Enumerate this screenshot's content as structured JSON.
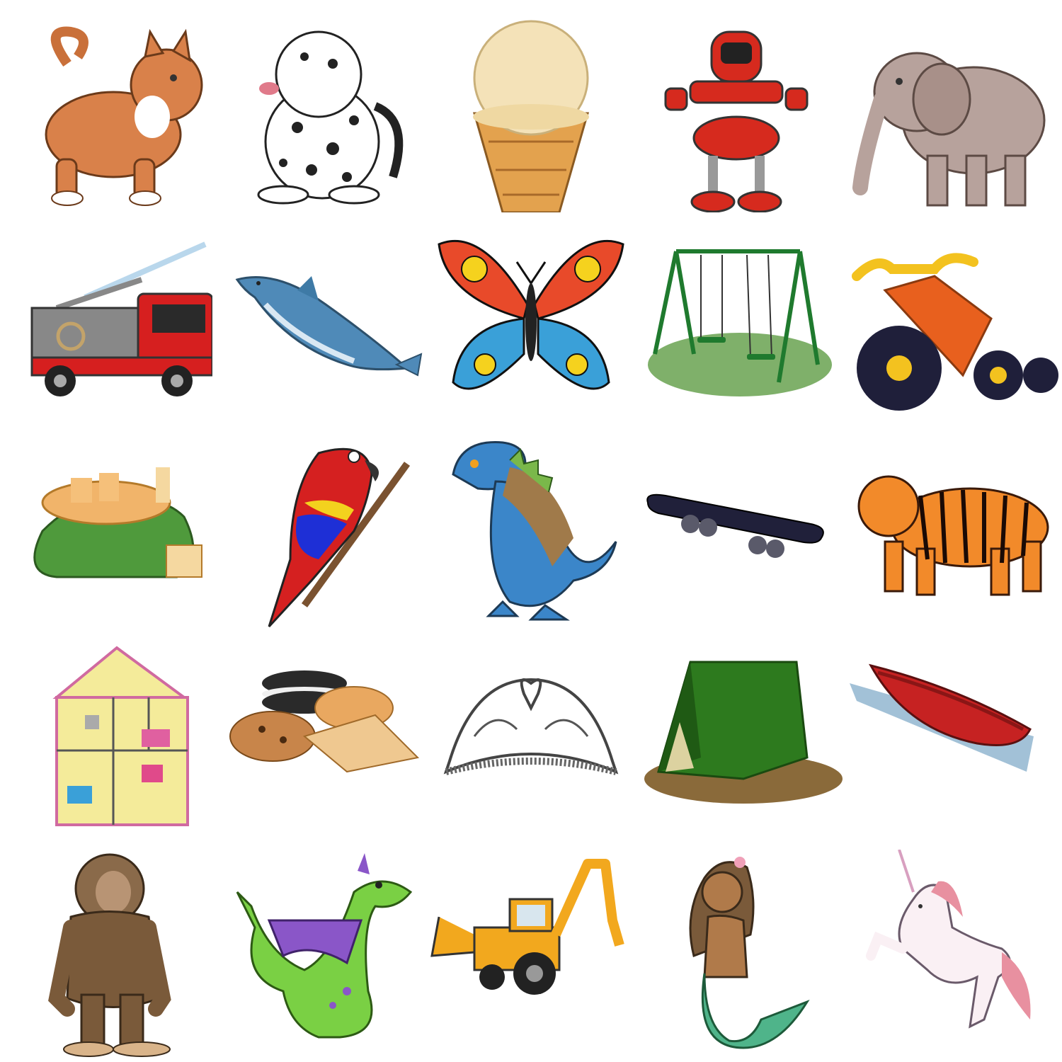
{
  "grid": {
    "rows": 5,
    "columns": 5,
    "items": [
      {
        "icon": "cat-icon"
      },
      {
        "icon": "dalmatian-puppy-icon"
      },
      {
        "icon": "ice-cream-cone-icon"
      },
      {
        "icon": "robot-icon"
      },
      {
        "icon": "elephant-icon"
      },
      {
        "icon": "fire-truck-icon"
      },
      {
        "icon": "dolphin-icon"
      },
      {
        "icon": "butterfly-icon"
      },
      {
        "icon": "swing-set-icon"
      },
      {
        "icon": "tricycle-icon"
      },
      {
        "icon": "treasure-bag-icon"
      },
      {
        "icon": "parrot-icon"
      },
      {
        "icon": "dinosaur-icon"
      },
      {
        "icon": "skateboard-icon"
      },
      {
        "icon": "tiger-icon"
      },
      {
        "icon": "dollhouse-icon"
      },
      {
        "icon": "cookies-icon"
      },
      {
        "icon": "tiara-icon"
      },
      {
        "icon": "tent-icon"
      },
      {
        "icon": "canoe-icon"
      },
      {
        "icon": "bigfoot-icon"
      },
      {
        "icon": "dragon-icon"
      },
      {
        "icon": "backhoe-icon"
      },
      {
        "icon": "mermaid-icon"
      },
      {
        "icon": "unicorn-icon"
      }
    ]
  },
  "colors": {
    "background": "#ffffff"
  }
}
